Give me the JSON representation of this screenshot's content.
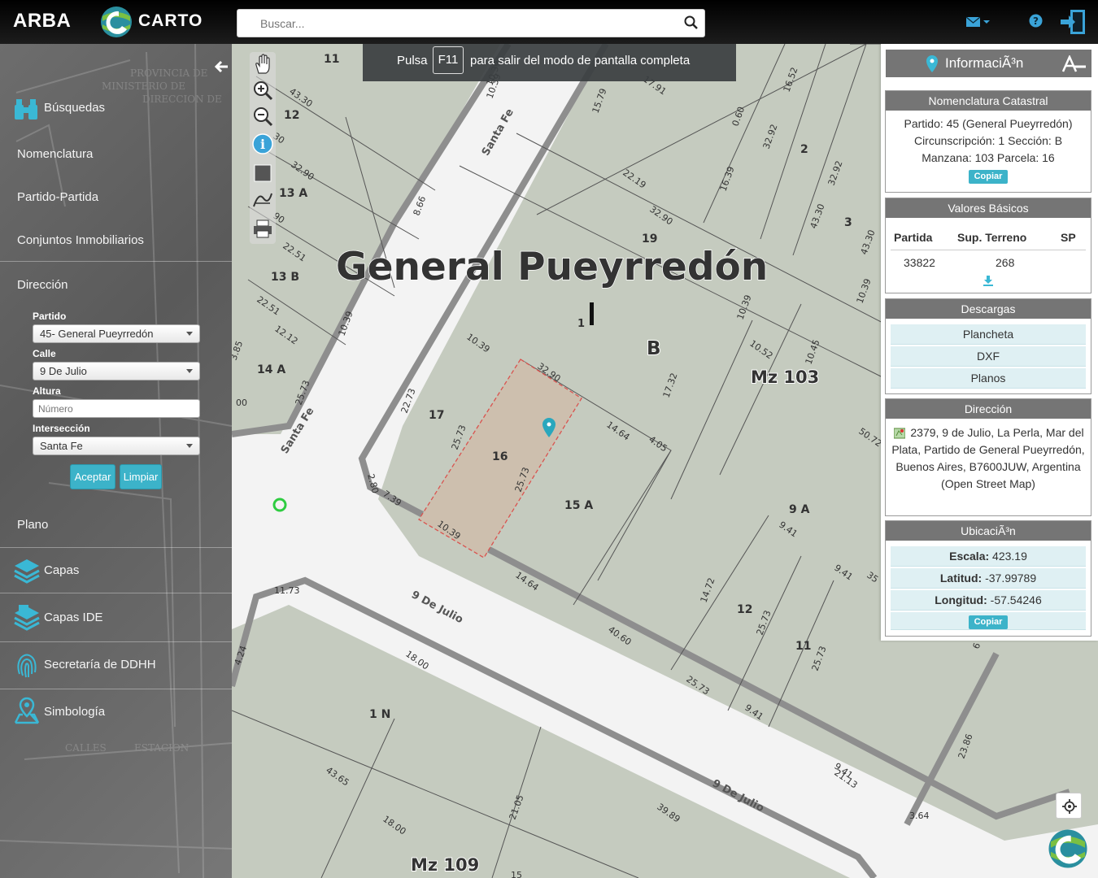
{
  "header": {
    "brand": "ARBA",
    "product": "CARTO",
    "search_placeholder": "Buscar...",
    "icons": [
      "search-icon",
      "mail-icon",
      "help-icon",
      "exit-icon"
    ]
  },
  "fullscreen_banner": {
    "prefix": "Pulsa",
    "key": "F11",
    "suffix": "para salir del modo de pantalla completa"
  },
  "sidebar": {
    "busquedas": "Búsquedas",
    "nomenclatura": "Nomenclatura",
    "partido_partida": "Partido-Partida",
    "conjuntos": "Conjuntos Inmobiliarios",
    "direccion": "Dirección",
    "form": {
      "partido_label": "Partido",
      "partido_value": "45- General Pueyrredón",
      "calle_label": "Calle",
      "calle_value": "9 De Julio",
      "altura_label": "Altura",
      "altura_placeholder": "Número",
      "interseccion_label": "Intersección",
      "interseccion_value": "Santa Fe",
      "aceptar": "Aceptar",
      "limpiar": "Limpiar"
    },
    "plano": "Plano",
    "capas": "Capas",
    "capas_ide": "Capas IDE",
    "ddhh": "Secretaría de DDHH",
    "simbologia": "Simbología"
  },
  "map": {
    "partido_name": "General Pueyrredón",
    "seccion": "B",
    "cursor_label": "1",
    "manzanas": [
      "Mz 103",
      "Mz 109"
    ],
    "streets": [
      "Santa Fe",
      "Santa Fe",
      "9 De Julio",
      "9 De Julio"
    ],
    "parcels": [
      "11",
      "12",
      "13 A",
      "13 B",
      "14 A",
      "17",
      "16",
      "15 A",
      "19",
      "2",
      "3",
      "9 A",
      "12",
      "11",
      "1 N"
    ],
    "measures": [
      "43.30",
      "30",
      "32.90",
      "90",
      "22.51",
      "22.51",
      "12.12",
      "3.85",
      "00",
      "10.39",
      "8.66",
      "10.39",
      "15.79",
      "17.91",
      "0.60",
      "16.52",
      "32.92",
      "16.39",
      "22.19",
      "32.90",
      "32.92",
      "43.30",
      "43.30",
      "10.39",
      "10.39",
      "10.52",
      "10.45",
      "50.72",
      "10.39",
      "32.90",
      "22.73",
      "25.73",
      "25.73",
      "14.64",
      "4.05",
      "17.32",
      "2.80",
      "7.39",
      "10.39",
      "14.64",
      "25.73",
      "11.73",
      "4.24",
      "18.00",
      "40.60",
      "14.72",
      "25.73",
      "9.41",
      "9.41",
      "35",
      "25.73",
      "25.73",
      "9.41",
      "9.41",
      "23.86",
      "21.13",
      "3.64",
      "39.89",
      "43.65",
      "18.00",
      "21.05",
      "15",
      "6",
      "10.39"
    ]
  },
  "panel": {
    "title": "InformaciÃ³n",
    "nomenclatura": {
      "header": "Nomenclatura Catastral",
      "line1": "Partido: 45 (General Pueyrredón)",
      "line2": "Circunscripción: 1 Sección: B",
      "line3": "Manzana: 103 Parcela: 16",
      "copy": "Copiar"
    },
    "valores": {
      "header": "Valores Básicos",
      "col1": "Partida",
      "col2": "Sup. Terreno",
      "col3": "SP",
      "partida": "33822",
      "sup": "268"
    },
    "descargas": {
      "header": "Descargas",
      "items": [
        "Plancheta",
        "DXF",
        "Planos"
      ]
    },
    "direccion": {
      "header": "Dirección",
      "text": "2379, 9 de Julio, La Perla, Mar del Plata, Partido de General Pueyrredón, Buenos Aires, B7600JUW, Argentina (Open Street Map)"
    },
    "ubicacion": {
      "header": "UbicaciÃ³n",
      "escala_label": "Escala:",
      "escala": "423.19",
      "latitud_label": "Latitud:",
      "latitud": "-37.99789",
      "longitud_label": "Longitud:",
      "longitud": "-57.54246",
      "copy": "Copiar"
    }
  },
  "colors": {
    "accent": "#3cb3c9",
    "header_bg": "#757575",
    "parcel_highlight": "#cdbfae",
    "parcel_border": "#d9534f",
    "map_block": "#c5cbbf",
    "street": "#f2f2f2",
    "block_outline": "#8c8c8c"
  }
}
